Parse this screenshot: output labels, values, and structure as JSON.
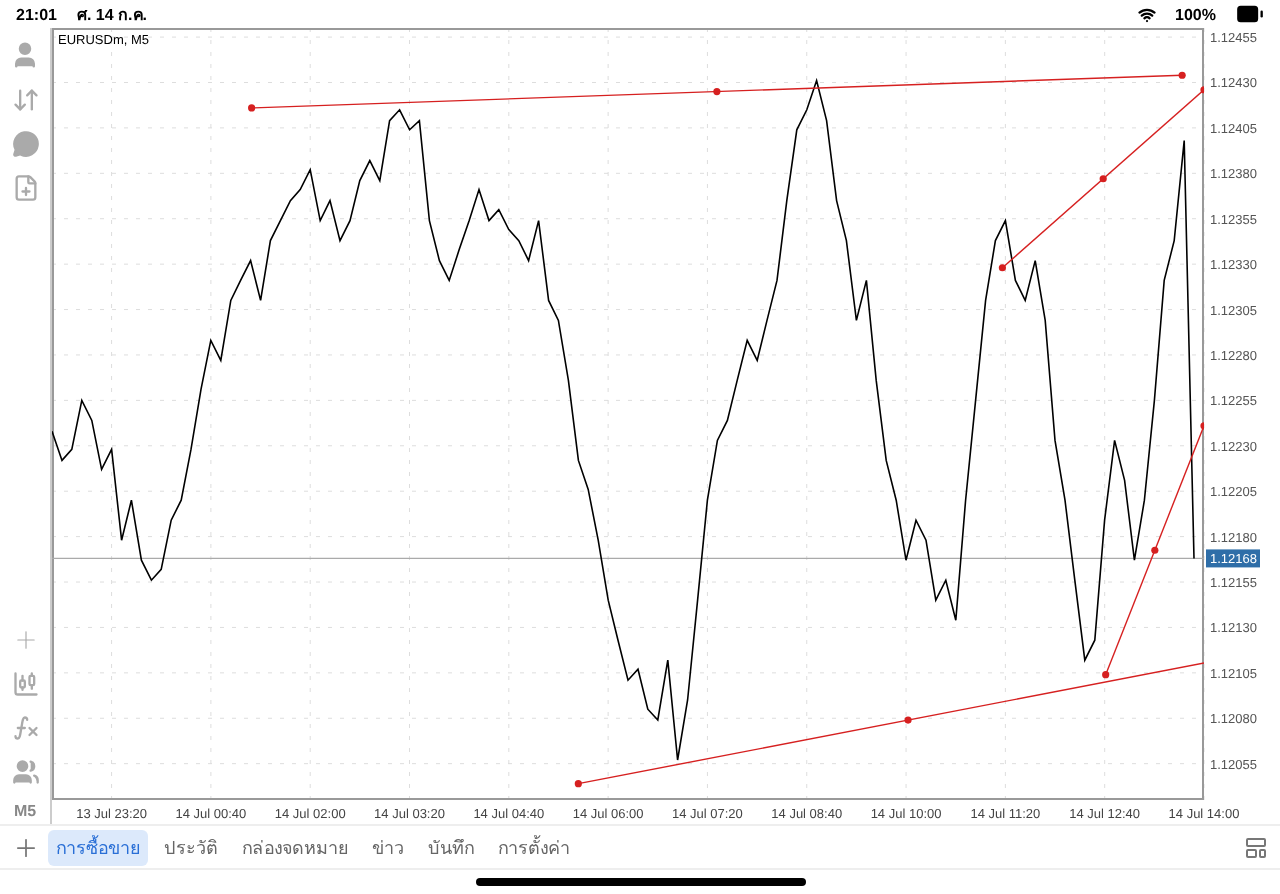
{
  "status_bar": {
    "time": "21:01",
    "date": "ศ. 14 ก.ค.",
    "battery": "100%"
  },
  "left_toolbar": {
    "timeframe": "M5"
  },
  "chart": {
    "title": "EURUSDm, M5",
    "chart_data": {
      "type": "line",
      "grid": true,
      "categories": [
        null,
        null,
        null,
        null,
        null,
        null,
        "13 Jul 23:20",
        null,
        null,
        null,
        null,
        null,
        null,
        null,
        null,
        null,
        "14 Jul 00:40",
        null,
        null,
        null,
        null,
        null,
        null,
        null,
        null,
        null,
        "14 Jul 02:00",
        null,
        null,
        null,
        null,
        null,
        null,
        null,
        null,
        null,
        "14 Jul 03:20",
        null,
        null,
        null,
        null,
        null,
        null,
        null,
        null,
        null,
        "14 Jul 04:40",
        null,
        null,
        null,
        null,
        null,
        null,
        null,
        null,
        null,
        "14 Jul 06:00",
        null,
        null,
        null,
        null,
        null,
        null,
        null,
        null,
        null,
        "14 Jul 07:20",
        null,
        null,
        null,
        null,
        null,
        null,
        null,
        null,
        null,
        "14 Jul 08:40",
        null,
        null,
        null,
        null,
        null,
        null,
        null,
        null,
        null,
        "14 Jul 10:00",
        null,
        null,
        null,
        null,
        null,
        null,
        null,
        null,
        null,
        "14 Jul 11:20",
        null,
        null,
        null,
        null,
        null,
        null,
        null,
        null,
        null,
        "14 Jul 12:40",
        null,
        null,
        null,
        null,
        null,
        null,
        null,
        null,
        null,
        "14 Jul 14:00"
      ],
      "series": [
        {
          "color": "#000000",
          "values": [
            1.12238,
            1.12222,
            1.12228,
            1.12255,
            1.12244,
            1.12217,
            1.12228,
            1.12178,
            1.122,
            1.12167,
            1.12156,
            1.12162,
            1.12189,
            1.122,
            1.12228,
            1.12261,
            1.12288,
            1.12277,
            1.1231,
            1.12321,
            1.12332,
            1.1231,
            1.12343,
            1.12354,
            1.12365,
            1.12371,
            1.12382,
            1.12354,
            1.12365,
            1.12343,
            1.12354,
            1.12376,
            1.12387,
            1.12376,
            1.12409,
            1.12415,
            1.12404,
            1.12409,
            1.12354,
            1.12332,
            1.12321,
            1.12338,
            1.12354,
            1.12371,
            1.12354,
            1.1236,
            1.12349,
            1.12343,
            1.12332,
            1.12354,
            1.1231,
            1.12299,
            1.12266,
            1.12222,
            1.12206,
            1.12178,
            1.12145,
            1.12123,
            1.12101,
            1.12107,
            1.12085,
            1.12079,
            1.12112,
            1.12057,
            1.1209,
            1.12145,
            1.122,
            1.12233,
            1.12244,
            1.12266,
            1.12288,
            1.12277,
            1.12299,
            1.12321,
            1.12365,
            1.12404,
            1.12415,
            1.12431,
            1.12409,
            1.12365,
            1.12343,
            1.12299,
            1.12321,
            1.12266,
            1.12222,
            1.122,
            1.12167,
            1.12189,
            1.12178,
            1.12145,
            1.12156,
            1.12134,
            1.122,
            1.12255,
            1.1231,
            1.12343,
            1.12354,
            1.12321,
            1.1231,
            1.12332,
            1.12299,
            1.12233,
            1.122,
            1.12156,
            1.12112,
            1.12123,
            1.12189,
            1.12233,
            1.12211,
            1.12167,
            1.122,
            1.12255,
            1.12321,
            1.12343,
            1.12398,
            1.12168,
            null
          ]
        }
      ],
      "ylim": [
        1.12035,
        1.1246
      ],
      "yticks": [
        {
          "value": 1.12455,
          "label": "1.12455"
        },
        {
          "value": 1.1243,
          "label": "1.12430"
        },
        {
          "value": 1.12405,
          "label": "1.12405"
        },
        {
          "value": 1.1238,
          "label": "1.12380"
        },
        {
          "value": 1.12355,
          "label": "1.12355"
        },
        {
          "value": 1.1233,
          "label": "1.12330"
        },
        {
          "value": 1.12305,
          "label": "1.12305"
        },
        {
          "value": 1.1228,
          "label": "1.12280"
        },
        {
          "value": 1.12255,
          "label": "1.12255"
        },
        {
          "value": 1.1223,
          "label": "1.12230"
        },
        {
          "value": 1.12205,
          "label": "1.12205"
        },
        {
          "value": 1.1218,
          "label": "1.12180"
        },
        {
          "value": 1.12155,
          "label": "1.12155"
        },
        {
          "value": 1.1213,
          "label": "1.12130"
        },
        {
          "value": 1.12105,
          "label": "1.12105"
        },
        {
          "value": 1.1208,
          "label": "1.12080"
        },
        {
          "value": 1.12055,
          "label": "1.12055"
        }
      ],
      "ref_lines": [
        {
          "axis": "y",
          "value": 1.12168,
          "label": "1.12168"
        }
      ]
    }
  },
  "tabs": [
    {
      "label": "การซื้อขาย",
      "selected": true
    },
    {
      "label": "ประวัติ",
      "selected": false
    },
    {
      "label": "กล่องจดหมาย",
      "selected": false
    },
    {
      "label": "ข่าว",
      "selected": false
    },
    {
      "label": "บันทึก",
      "selected": false
    },
    {
      "label": "การตั้งค่า",
      "selected": false
    }
  ]
}
